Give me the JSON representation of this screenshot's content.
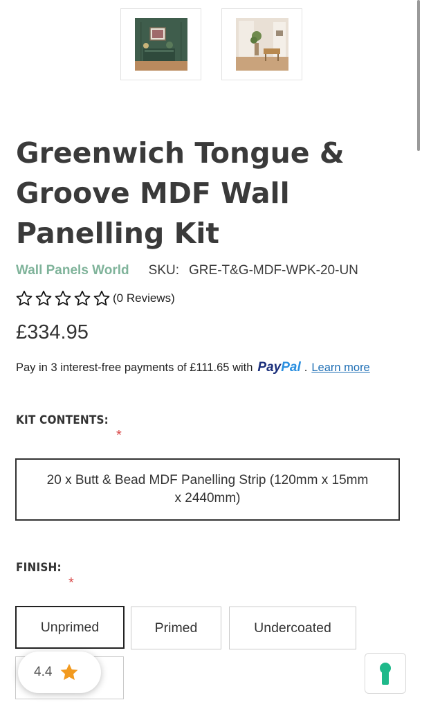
{
  "gallery": {
    "thumbnails": [
      {
        "name": "green-panelled-room",
        "alt": ""
      },
      {
        "name": "hallway-room",
        "alt": ""
      }
    ]
  },
  "product": {
    "title": "Greenwich Tongue & Groove MDF Wall Panelling Kit",
    "brand": "Wall Panels World",
    "sku_label": "SKU:",
    "sku_value": "GRE-T&G-MDF-WPK-20-UN",
    "star_rating": 0,
    "star_max": 5,
    "reviews_text": "(0 Reviews)",
    "price": "£334.95"
  },
  "paypal": {
    "text": "Pay in 3 interest-free payments of £111.65 with",
    "logo_pay": "Pay",
    "logo_pal": "Pal",
    "dot": ".",
    "link": "Learn more"
  },
  "kit_contents": {
    "label": "KIT CONTENTS:",
    "required_mark": "*",
    "value": "20 x Butt & Bead MDF Panelling Strip (120mm x 15mm x 2440mm)"
  },
  "finish": {
    "label": "FINISH:",
    "required_mark": "*",
    "options": [
      "Unprimed",
      "Primed",
      "Undercoated",
      ""
    ],
    "selected": "Unprimed"
  },
  "widgets": {
    "rating_value": "4.4",
    "rating_icon": "star-icon",
    "lock_icon": "keyhole-icon"
  },
  "colors": {
    "brand_green": "#7fb39a",
    "paypal_dark": "#1b2f7b",
    "paypal_light": "#2a8fe0",
    "link_blue": "#1f6fb5",
    "required_red": "#d94a4a",
    "star_orange": "#f29a1f",
    "lock_green": "#1fb98a"
  }
}
